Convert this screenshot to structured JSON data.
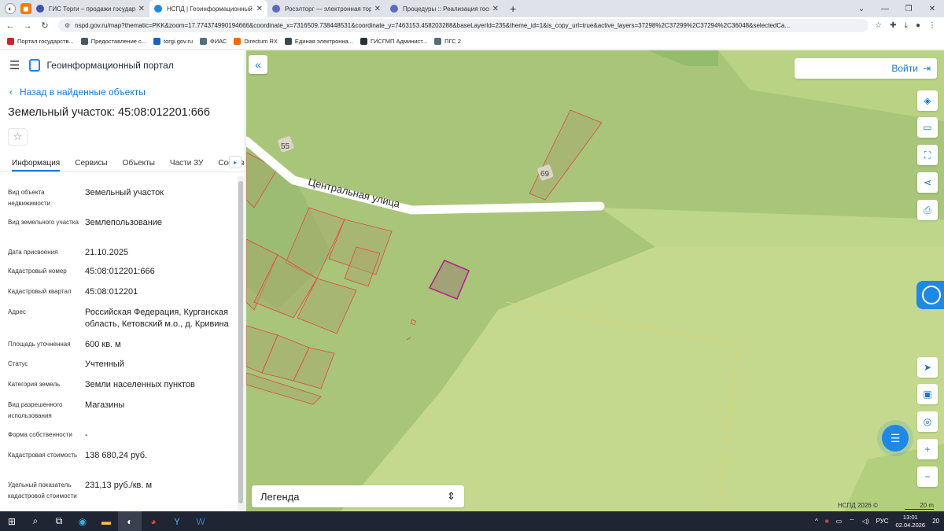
{
  "browser": {
    "tabs": [
      {
        "title": "ГИС Торги – продажи государс",
        "active": false
      },
      {
        "title": "НСПД | Геоинформационный п",
        "active": true
      },
      {
        "title": "Росэлторг — электронная торгс",
        "active": false
      },
      {
        "title": "Процедуры :: Реализация госим",
        "active": false
      }
    ],
    "new_tab": "+",
    "url": "nspd.gov.ru/map?thematic=PKK&zoom=17.774374990194666&coordinate_x=7316509.738448531&coordinate_y=7463153.458203288&baseLayerId=235&theme_id=1&is_copy_url=true&active_layers=37298%2C37299%2C37294%2C36048&selectedCa...",
    "bookmarks": [
      {
        "label": "Портал государств...",
        "color": "#c62828"
      },
      {
        "label": "Предоставление с...",
        "color": "#455a64"
      },
      {
        "label": "torgi.gov.ru",
        "color": "#1565c0"
      },
      {
        "label": "ФИАС",
        "color": "#546e7a"
      },
      {
        "label": "Directum RX",
        "color": "#ef6c00"
      },
      {
        "label": "Единая электронна...",
        "color": "#37474f"
      },
      {
        "label": "ГИСГМП Админист...",
        "color": "#263238"
      },
      {
        "label": "ПГС 2",
        "color": "#546e7a"
      }
    ]
  },
  "panel": {
    "portal_title": "Геоинформационный портал",
    "back_link": "Назад в найденные объекты",
    "object_title": "Земельный участок: 45:08:012201:666",
    "tabs": [
      "Информация",
      "Сервисы",
      "Объекты",
      "Части ЗУ",
      "Состав"
    ],
    "attributes": [
      {
        "key": "Вид объекта недвижимости",
        "value": "Земельный участок"
      },
      {
        "key": "Вид земельного участка",
        "value": "Землепользование"
      },
      {
        "key": "Дата присвоения",
        "value": "21.10.2025"
      },
      {
        "key": "Кадастровый номер",
        "value": "45:08:012201:666"
      },
      {
        "key": "Кадастровый квартал",
        "value": "45:08:012201"
      },
      {
        "key": "Адрес",
        "value": "Российская Федерация, Курганская область, Кетовский м.о., д. Кривина"
      },
      {
        "key": "Площадь уточненная",
        "value": "600 кв. м"
      },
      {
        "key": "Статус",
        "value": "Учтенный"
      },
      {
        "key": "Категория земель",
        "value": "Земли населенных пунктов"
      },
      {
        "key": "Вид разрешенного использования",
        "value": "Магазины"
      },
      {
        "key": "Форма собственности",
        "value": "-"
      },
      {
        "key": "Кадастровая стоимость",
        "value": "138 680,24 руб."
      },
      {
        "key": "Удельный показатель кадастровой стоимости",
        "value": "231,13 руб./кв. м"
      }
    ]
  },
  "map": {
    "street_label": "Центральная улица",
    "house_numbers": [
      "55",
      "69"
    ],
    "login_label": "Войти",
    "legend_label": "Легенда",
    "copyright": "НСПД 2026 ©",
    "scale_label": "20 m",
    "colors": {
      "background": "#a8c57a",
      "light_field": "#c4d98d",
      "parcel_outline": "#e0483b",
      "selected_parcel": "#b5208f",
      "road": "#ffffff"
    }
  },
  "taskbar": {
    "language": "РУС",
    "time": "13:01",
    "date": "02.04.2026",
    "notifications": "20"
  }
}
